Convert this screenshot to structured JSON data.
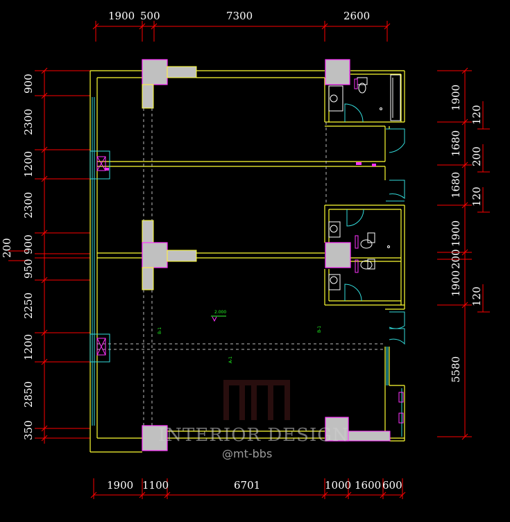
{
  "dimensions": {
    "top": [
      "1900",
      "500",
      "7300",
      "2600"
    ],
    "bottom": [
      "1900",
      "1100",
      "6701",
      "1000",
      "1600",
      "600"
    ],
    "left": [
      "900",
      "2300",
      "1200",
      "2300",
      "900",
      "950",
      "2250",
      "1200",
      "2850",
      "350"
    ],
    "left_outer": "200",
    "right": [
      "1900",
      "120",
      "1680",
      "200",
      "1680",
      "120",
      "1900",
      "200",
      "1900",
      "120",
      "5580"
    ]
  },
  "annotations": {
    "level_mark": "2.000",
    "tag_a": "B-1",
    "tag_b": "B-1",
    "tag_c": "A-1"
  },
  "watermark": {
    "text": "INTERIOR DESIGN",
    "handle": "@mt-bbs"
  }
}
